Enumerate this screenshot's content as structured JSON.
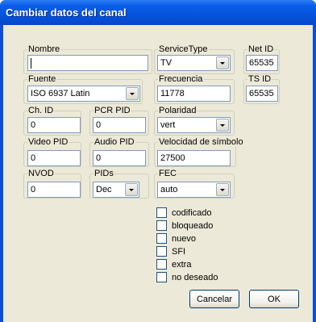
{
  "window": {
    "title": "Cambiar datos del canal"
  },
  "fields": {
    "nombre": {
      "label": "Nombre",
      "value": ""
    },
    "service_type": {
      "label": "ServiceType",
      "value": "TV"
    },
    "net_id": {
      "label": "Net ID",
      "value": "65535"
    },
    "fuente": {
      "label": "Fuente",
      "value": "ISO 6937 Latin"
    },
    "frecuencia": {
      "label": "Frecuencia",
      "value": "11778"
    },
    "ts_id": {
      "label": "TS ID",
      "value": "65535"
    },
    "ch_id": {
      "label": "Ch. ID",
      "value": "0"
    },
    "pcr_pid": {
      "label": "PCR PID",
      "value": "0"
    },
    "polaridad": {
      "label": "Polaridad",
      "value": "vert"
    },
    "video_pid": {
      "label": "Video PID",
      "value": "0"
    },
    "audio_pid": {
      "label": "Audio PID",
      "value": "0"
    },
    "velocidad": {
      "label": "Velocidad de símbolo",
      "value": "27500"
    },
    "nvod": {
      "label": "NVOD",
      "value": "0"
    },
    "pids": {
      "label": "PIDs",
      "value": "Dec"
    },
    "fec": {
      "label": "FEC",
      "value": "auto"
    }
  },
  "checkboxes": [
    {
      "label": "codificado",
      "checked": false
    },
    {
      "label": "bloqueado",
      "checked": false
    },
    {
      "label": "nuevo",
      "checked": false
    },
    {
      "label": "SFI",
      "checked": false
    },
    {
      "label": "extra",
      "checked": false
    },
    {
      "label": "no deseado",
      "checked": false
    }
  ],
  "buttons": {
    "cancel": "Cancelar",
    "ok": "OK"
  }
}
